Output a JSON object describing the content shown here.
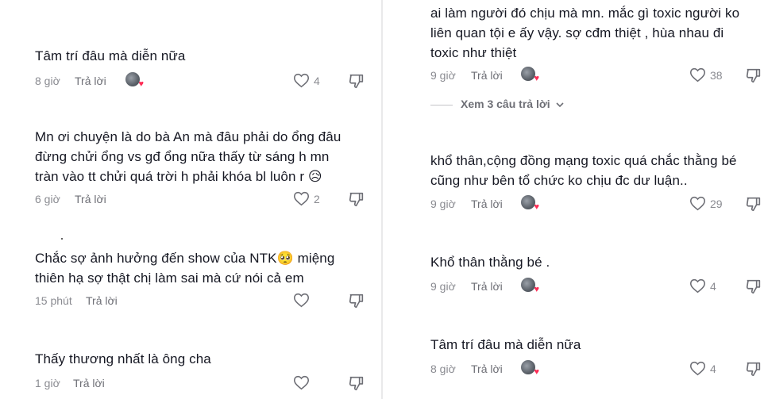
{
  "left_column": {
    "comments": [
      {
        "text_lines": [
          "Tâm trí đâu mà diễn nữa"
        ],
        "time": "8 giờ",
        "reply_label": "Trả lời",
        "likes": "4"
      },
      {
        "text_lines": [
          "Mn ơi chuyện là do bà An mà đâu phải do ổng đâu",
          "đừng chửi ổng vs gđ ổng nữa thấy từ sáng h mn",
          "tràn vào tt chửi quá trời h phải khóa bl luôn r 😥"
        ],
        "time": "6 giờ",
        "reply_label": "Trả lời",
        "likes": "2"
      },
      {
        "text_lines": [
          "Chắc sợ ảnh hưởng đến show của NTK🥺 miệng",
          "thiên hạ sợ thật chị làm sai mà cứ nói cả em"
        ],
        "time": "15 phút",
        "reply_label": "Trả lời",
        "likes": ""
      },
      {
        "text_lines": [
          "Thấy thương nhất là ông cha"
        ],
        "time": "1 giờ",
        "reply_label": "Trả lời",
        "likes": ""
      }
    ]
  },
  "right_column": {
    "comments": [
      {
        "text_lines": [
          "ai làm người đó chịu mà mn. mắc gì toxic người ko",
          "liên quan tội e ấy vậy. sợ cđm thiệt , hùa nhau đi",
          "toxic như thiệt"
        ],
        "time": "9 giờ",
        "reply_label": "Trả lời",
        "likes": "38"
      },
      {
        "text_lines": [
          "khổ thân,cộng đồng mạng toxic quá chắc thằng bé",
          "cũng như bên tổ chức ko chịu đc dư luận.."
        ],
        "time": "9 giờ",
        "reply_label": "Trả lời",
        "likes": "29"
      },
      {
        "text_lines": [
          "Khổ thân thằng bé ."
        ],
        "time": "9 giờ",
        "reply_label": "Trả lời",
        "likes": "4"
      },
      {
        "text_lines": [
          "Tâm trí đâu mà diễn nữa"
        ],
        "time": "8 giờ",
        "reply_label": "Trả lời",
        "likes": "4"
      }
    ],
    "view_replies_label": "Xem 3 câu trả lời"
  },
  "icons": {
    "like": "heart-outline-icon",
    "dislike": "thumbs-down-outline-icon",
    "expand": "chevron-down-icon"
  },
  "colors": {
    "text": "#161823",
    "meta": "#8a8b91",
    "heart_badge": "#fe2c55"
  }
}
